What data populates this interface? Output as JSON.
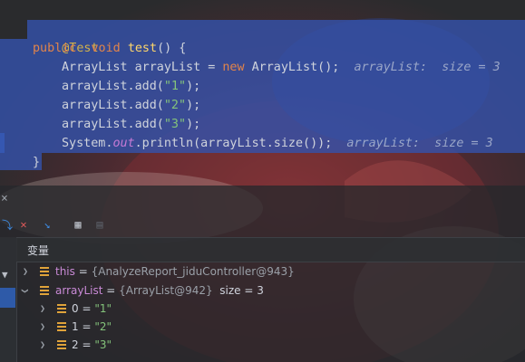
{
  "editor": {
    "lines": [
      {
        "annotation": "@Test"
      },
      {
        "kw": "public  void ",
        "fn": "test",
        "rest": "() {"
      },
      {
        "code": "ArrayList arrayList = ",
        "kw": "new",
        "rest": " ArrayList();",
        "hint": "arrayList:  size = 3"
      },
      {
        "code": "arrayList.add(",
        "str": "\"1\"",
        "rest": ");"
      },
      {
        "code": "arrayList.add(",
        "str": "\"2\"",
        "rest": ");"
      },
      {
        "code": "arrayList.add(",
        "str": "\"3\"",
        "rest": ");"
      },
      {
        "code": "System.",
        "field": "out",
        "rest": ".println(arrayList.size());",
        "hint": "arrayList:  size = 3"
      },
      {
        "close": "}"
      }
    ]
  },
  "debug": {
    "close_icon": "×",
    "variables_title": "变量",
    "variables": [
      {
        "name": "this",
        "eq": " = ",
        "value": "{AnalyzeReport_jiduController@943}",
        "extra": "",
        "expanded": false
      },
      {
        "name": "arrayList",
        "eq": " = ",
        "value": "{ArrayList@942}",
        "extra": "  size = 3",
        "expanded": true
      },
      {
        "name": "0",
        "eq": " = ",
        "value": "\"1\"",
        "child": true
      },
      {
        "name": "1",
        "eq": " = ",
        "value": "\"2\"",
        "child": true
      },
      {
        "name": "2",
        "eq": " = ",
        "value": "\"3\"",
        "child": true
      }
    ]
  },
  "colors": {
    "selection": "#3452aa",
    "keyword": "#e2844a",
    "string": "#84c37b",
    "field_icon": "#e0a33a"
  }
}
